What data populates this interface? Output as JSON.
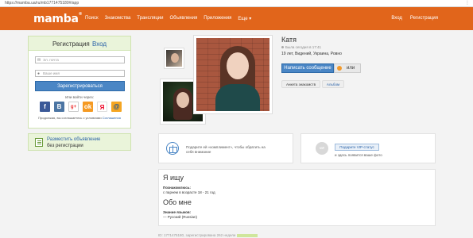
{
  "browser": {
    "url": "https://mamba.ua/ru/mb1771475180#/app"
  },
  "header": {
    "logo": "mamba",
    "logo_mark": "®",
    "nav": [
      "Поиск",
      "Знакомства",
      "Трансляции",
      "Объявления",
      "Приложения",
      "Еще"
    ],
    "more_arrow": "▾",
    "right_nav": [
      "Вход",
      "Регистрация"
    ],
    "accent_color": "#e1651b"
  },
  "registration": {
    "tab_register": "Регистрация",
    "tab_login": "Вход",
    "email_placeholder": "Эл. почта",
    "name_placeholder": "Ваше имя",
    "submit_label": "Зарегистрироваться",
    "via_label": "Или войти через:",
    "social_icons": [
      "facebook-icon",
      "vkontakte-icon",
      "google-plus-icon",
      "odnoklassniki-icon",
      "yandex-icon",
      "mailru-icon"
    ],
    "terms_text": "Продолжая, вы соглашаетесь с условиями",
    "terms_link": "Соглашения"
  },
  "advert": {
    "line1": "Разместить объявление",
    "line2": "без регистрации"
  },
  "profile": {
    "name": "Катя",
    "last_seen": "Была сегодня в 17:41",
    "info": "19 лет, Видений, Украина, Ровно",
    "message_button": "Написать сообщение",
    "or_label": "или",
    "tag_anketa": "Анкета знакомств",
    "tag_album": "Альбом"
  },
  "promo": {
    "gift_text": "Подарите ей «комплимент», чтобы обратить на себя внимание",
    "vip_badge": "VIP",
    "vip_button": "Подарите VIP-статус",
    "vip_text": "и здесь появится ваше фото"
  },
  "bio": {
    "seeking_title": "Я ищу",
    "seeking_key": "Познакомлюсь:",
    "seeking_value": "с парнем в возрасте 18 - 21 год",
    "about_title": "Обо мне",
    "lang_key": "Знание языков:",
    "lang_value": "— Русский (Russian)"
  },
  "footer": {
    "text": "ID: 1771475180, зарегистрирована 262 недели"
  }
}
